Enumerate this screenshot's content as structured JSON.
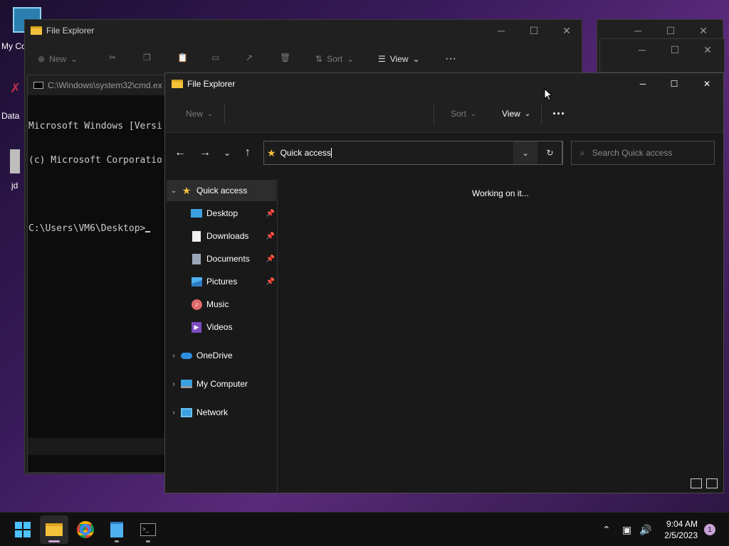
{
  "desktop": {
    "icons": [
      {
        "label": "My Co",
        "icon": "computer-icon"
      },
      {
        "label": "Data",
        "icon": "data-icon"
      },
      {
        "label": "jd",
        "icon": "file-icon"
      }
    ]
  },
  "bg_explorer": {
    "title": "File Explorer",
    "new_label": "New",
    "sort_label": "Sort",
    "view_label": "View"
  },
  "cmd": {
    "title": "C:\\Windows\\system32\\cmd.ex",
    "lines": [
      "Microsoft Windows [Versi",
      "(c) Microsoft Corporatio",
      "",
      "C:\\Users\\VM6\\Desktop>"
    ]
  },
  "explorer": {
    "title": "File Explorer",
    "toolbar": {
      "new_label": "New",
      "sort_label": "Sort",
      "view_label": "View",
      "more_label": "···"
    },
    "address": "Quick access",
    "search_placeholder": "Search Quick access",
    "status_message": "Working on it...",
    "sidebar": {
      "quick_access": "Quick access",
      "pinned": [
        {
          "label": "Desktop",
          "icon": "desktop-folder-icon",
          "pinned": true
        },
        {
          "label": "Downloads",
          "icon": "downloads-folder-icon",
          "pinned": true
        },
        {
          "label": "Documents",
          "icon": "documents-folder-icon",
          "pinned": true
        },
        {
          "label": "Pictures",
          "icon": "pictures-folder-icon",
          "pinned": true
        },
        {
          "label": "Music",
          "icon": "music-folder-icon",
          "pinned": false
        },
        {
          "label": "Videos",
          "icon": "videos-folder-icon",
          "pinned": false
        }
      ],
      "roots": [
        {
          "label": "OneDrive",
          "icon": "onedrive-icon"
        },
        {
          "label": "My Computer",
          "icon": "computer-icon"
        },
        {
          "label": "Network",
          "icon": "network-icon"
        }
      ]
    }
  },
  "taskbar": {
    "apps": [
      "start-icon",
      "file-explorer-icon",
      "chrome-icon",
      "notepad-icon",
      "terminal-icon"
    ],
    "time": "9:04 AM",
    "date": "2/5/2023",
    "notification_count": "1"
  },
  "colors": {
    "accent": "#0078d4",
    "folder": "#f3c13a",
    "star": "#f3c13a"
  }
}
